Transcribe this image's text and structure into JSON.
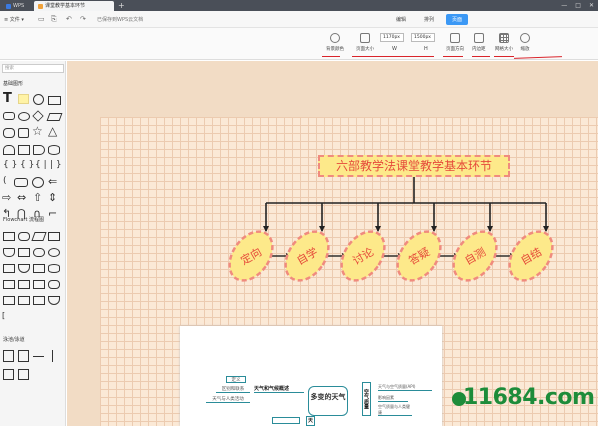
{
  "titlebar": {
    "tabs": [
      {
        "label": "WPS"
      },
      {
        "label": "课堂教学基本环节"
      }
    ]
  },
  "menubar": {
    "file_label": "≡ 文件 ▾",
    "saved_label": "已保存到WPS云文档",
    "modes": [
      {
        "label": "编辑"
      },
      {
        "label": "排列"
      },
      {
        "label": "页面"
      }
    ]
  },
  "toolbar": {
    "tools": [
      {
        "label": "背景颜色",
        "icon": "paint-icon"
      },
      {
        "label": "页面大小",
        "icon": "page-size-icon"
      },
      {
        "label": "页面方向",
        "icon": "orientation-icon"
      },
      {
        "label": "内边距",
        "icon": "padding-icon"
      },
      {
        "label": "网格大小",
        "icon": "grid-icon"
      },
      {
        "label": "缩放",
        "icon": "zoom-icon"
      }
    ],
    "width_value": "1170px",
    "height_value": "1500px",
    "width_caption": "W",
    "height_caption": "H",
    "underline_color": "#d9242b"
  },
  "sidebar": {
    "search_placeholder": "搜索",
    "sections": [
      {
        "title": "基础图形"
      },
      {
        "title": "Flowchart 流程图"
      },
      {
        "title": "泳池/泳道"
      }
    ]
  },
  "diagram": {
    "title": "六部教学法课堂教学基本环节",
    "steps": [
      "定向",
      "自学",
      "讨论",
      "答疑",
      "自测",
      "自结"
    ],
    "colors": {
      "fill": "#fde98a",
      "border": "#f08b7e",
      "text": "#e54a3a",
      "line": "#222222"
    }
  },
  "mindmap": {
    "center": "多变的天气",
    "left_main": "天气和气候概述",
    "left_items": [
      "定义",
      "区别和联系",
      "天气与人类活动"
    ],
    "right_main": "空气质量",
    "right_items": [
      "天气与空气质量(API)",
      "影响因素",
      "空气质量与人类健康"
    ],
    "bottom_label": "天"
  },
  "watermark": "11684.com"
}
